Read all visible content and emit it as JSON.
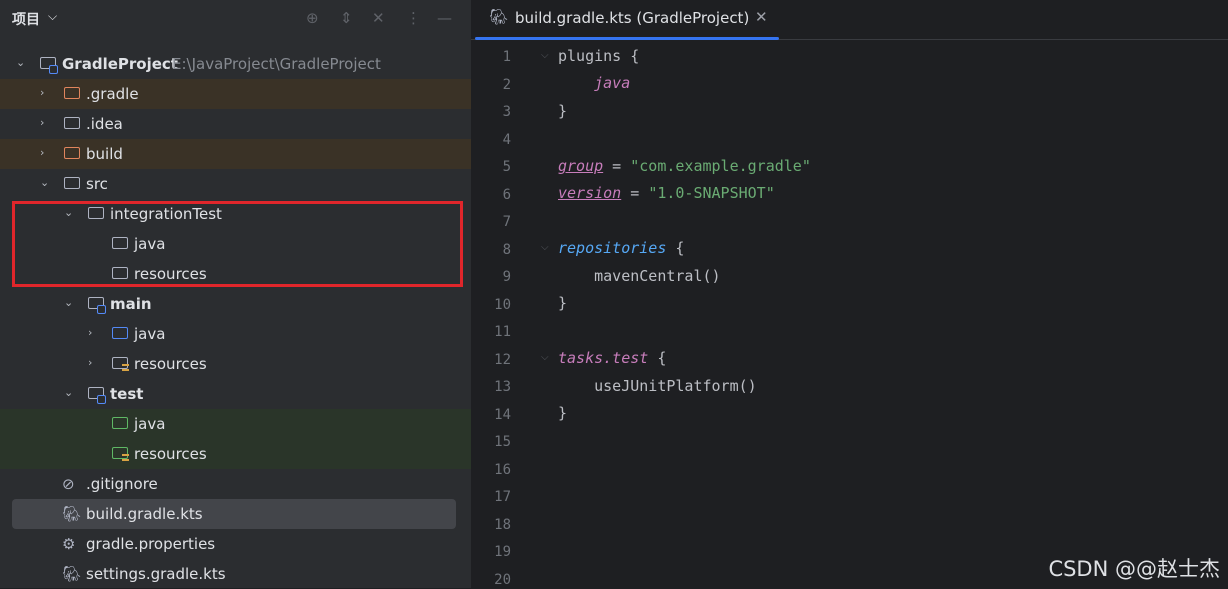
{
  "project_panel": {
    "title": "项目",
    "header_icons": [
      "crosshair-icon",
      "expand-icon",
      "collapse-icon",
      "more-icon",
      "minimize-icon"
    ],
    "root": {
      "name": "GradleProject",
      "path": "E:\\JavaProject\\GradleProject"
    },
    "tree": [
      {
        "label": ".gradle"
      },
      {
        "label": ".idea"
      },
      {
        "label": "build"
      },
      {
        "label": "src"
      },
      {
        "label": "integrationTest"
      },
      {
        "label": "java"
      },
      {
        "label": "resources"
      },
      {
        "label": "main"
      },
      {
        "label": "java"
      },
      {
        "label": "resources"
      },
      {
        "label": "test"
      },
      {
        "label": "java"
      },
      {
        "label": "resources"
      },
      {
        "label": ".gitignore"
      },
      {
        "label": "build.gradle.kts"
      },
      {
        "label": "gradle.properties"
      },
      {
        "label": "settings.gradle.kts"
      }
    ]
  },
  "editor": {
    "tab_label": "build.gradle.kts (GradleProject)",
    "line_numbers": [
      "1",
      "2",
      "3",
      "4",
      "5",
      "6",
      "7",
      "8",
      "9",
      "10",
      "11",
      "12",
      "13",
      "14",
      "15",
      "16",
      "17",
      "18",
      "19",
      "20"
    ],
    "code": {
      "plugins": "plugins",
      "brace_open": " {",
      "java": "java",
      "brace_close": "}",
      "group": "group",
      "group_eq": " = ",
      "group_val": "\"com.example.gradle\"",
      "version": "version",
      "version_eq": " = ",
      "version_val": "\"1.0-SNAPSHOT\"",
      "repositories": "repositories",
      "maven": "mavenCentral()",
      "tasks_test": "tasks.test",
      "junit": "useJUnitPlatform()"
    }
  },
  "watermark": "CSDN @@赵士杰",
  "colors": {
    "accent": "#3574f0",
    "highlight_box": "#e0262b",
    "excluded_row": "#3a3226",
    "test_row": "#2a3529"
  }
}
